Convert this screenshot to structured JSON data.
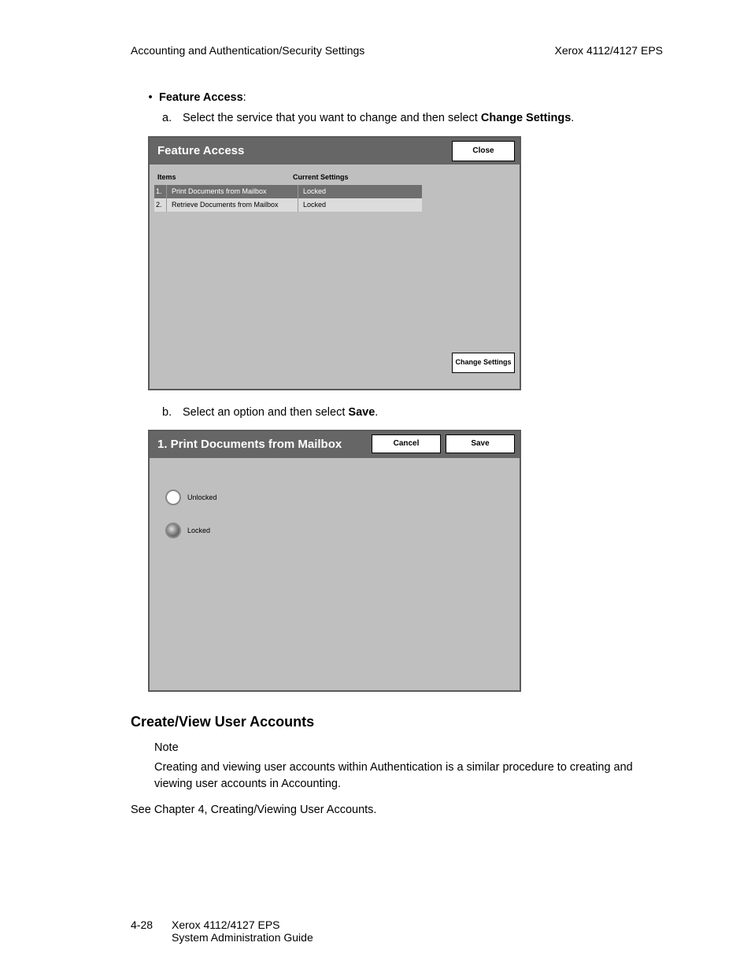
{
  "header": {
    "left": "Accounting and Authentication/Security Settings",
    "right": "Xerox 4112/4127 EPS"
  },
  "bullet": {
    "label": "Feature Access",
    "colon": ":"
  },
  "step_a": {
    "letter": "a.",
    "pre": "Select the service that you want to change and then select ",
    "bold": "Change Settings",
    "post": "."
  },
  "dialog1": {
    "title": "Feature Access",
    "close": "Close",
    "col_items": "Items",
    "col_settings": "Current Settings",
    "rows": [
      {
        "num": "1.",
        "name": "Print Documents from Mailbox",
        "setting": "Locked"
      },
      {
        "num": "2.",
        "name": "Retrieve Documents from Mailbox",
        "setting": "Locked"
      }
    ],
    "change_settings": "Change Settings"
  },
  "step_b": {
    "letter": "b.",
    "pre": "Select an option and then select ",
    "bold": "Save",
    "post": "."
  },
  "dialog2": {
    "title": "1. Print Documents from Mailbox",
    "cancel": "Cancel",
    "save": "Save",
    "opt_unlocked": "Unlocked",
    "opt_locked": "Locked"
  },
  "section": {
    "title": "Create/View User Accounts",
    "note_word": "Note",
    "note_body": "Creating and viewing user accounts within Authentication is a similar procedure to creating and viewing user accounts in Accounting.",
    "see": "See Chapter 4, Creating/Viewing User Accounts."
  },
  "footer": {
    "pagenum": "4-28",
    "line1": "Xerox 4112/4127 EPS",
    "line2": "System Administration Guide"
  }
}
